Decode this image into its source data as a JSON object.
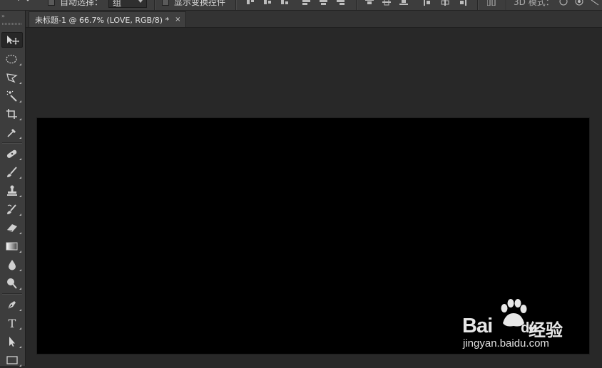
{
  "options_bar": {
    "auto_select_label": "自动选择：",
    "auto_select_value": "组",
    "show_transform_label": "显示变换控件",
    "mode_3d_label": "3D 模式："
  },
  "document": {
    "tab_title": "未标题-1 @ 66.7% (LOVE, RGB/8) *",
    "close_glyph": "×",
    "canvas_color": "#000000"
  },
  "tools": [
    {
      "name": "move-tool-icon",
      "active": true
    },
    {
      "name": "elliptical-marquee-tool-icon"
    },
    {
      "name": "polygonal-lasso-tool-icon"
    },
    {
      "name": "magic-wand-tool-icon"
    },
    {
      "name": "crop-tool-icon"
    },
    {
      "name": "eyedropper-tool-icon"
    },
    {
      "name": "healing-brush-tool-icon"
    },
    {
      "name": "brush-tool-icon"
    },
    {
      "name": "clone-stamp-tool-icon"
    },
    {
      "name": "history-brush-tool-icon"
    },
    {
      "name": "eraser-tool-icon"
    },
    {
      "name": "gradient-tool-icon"
    },
    {
      "name": "blur-tool-icon"
    },
    {
      "name": "dodge-tool-icon"
    },
    {
      "name": "pen-tool-icon"
    },
    {
      "name": "type-tool-icon",
      "glyph": "T"
    },
    {
      "name": "path-selection-tool-icon"
    },
    {
      "name": "rectangle-tool-icon"
    }
  ],
  "collapse_glyph": "»",
  "watermark": {
    "brand": "Bai",
    "brand_suffix": "du",
    "jingyan": "经验",
    "url": "jingyan.baidu.com"
  },
  "colors": {
    "panel": "#3d3d3d",
    "workspace": "#282828",
    "canvas": "#000000"
  }
}
